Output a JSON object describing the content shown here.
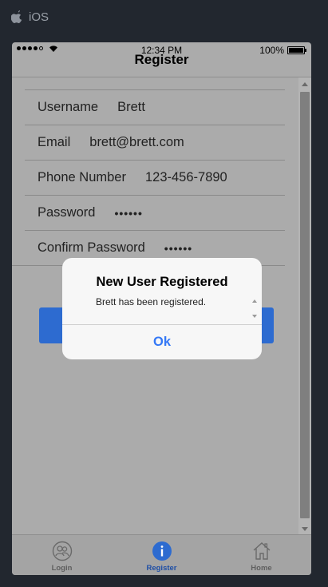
{
  "platform": {
    "label": "iOS"
  },
  "status_bar": {
    "time": "12:34 PM",
    "battery": "100%"
  },
  "nav": {
    "title": "Register"
  },
  "form": {
    "fields": [
      {
        "label": "Username",
        "value": "Brett"
      },
      {
        "label": "Email",
        "value": "brett@brett.com"
      },
      {
        "label": "Phone Number",
        "value": "123-456-7890"
      },
      {
        "label": "Password",
        "value": "••••••"
      },
      {
        "label": "Confirm Password",
        "value": "••••••"
      }
    ]
  },
  "dialog": {
    "title": "New User Registered",
    "message": "Brett has been registered.",
    "ok_label": "Ok"
  },
  "tabs": [
    {
      "label": "Login",
      "icon": "users-icon"
    },
    {
      "label": "Register",
      "icon": "info-icon",
      "active": true
    },
    {
      "label": "Home",
      "icon": "home-icon"
    }
  ],
  "colors": {
    "accent": "#2d6bd0",
    "dialog_button": "#3478f6",
    "overlay_bg": "#ababab"
  }
}
